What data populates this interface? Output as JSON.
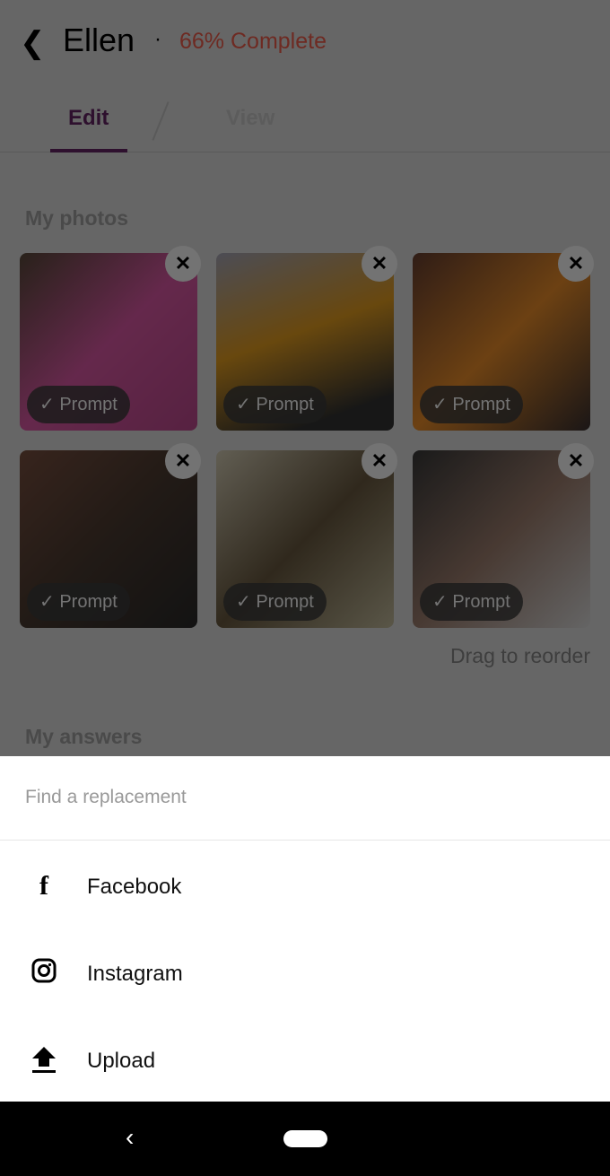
{
  "header": {
    "back_icon": "chevron-left-icon",
    "name": "Ellen",
    "separator": "·",
    "completion": "66% Complete",
    "completion_color": "#b0382a"
  },
  "tabs": [
    {
      "label": "Edit",
      "active": true
    },
    {
      "label": "View",
      "active": false
    }
  ],
  "photos_section": {
    "title": "My photos",
    "prompt_label": "Prompt",
    "remove_label": "✕",
    "drag_hint": "Drag to reorder"
  },
  "answers_section": {
    "title": "My answers"
  },
  "sheet": {
    "title": "Find a replacement",
    "options": [
      {
        "label": "Facebook",
        "icon": "facebook-icon"
      },
      {
        "label": "Instagram",
        "icon": "instagram-icon"
      },
      {
        "label": "Upload",
        "icon": "upload-icon"
      }
    ]
  },
  "navbar": {
    "back_icon": "nav-back-icon",
    "home_icon": "home-pill-icon"
  }
}
